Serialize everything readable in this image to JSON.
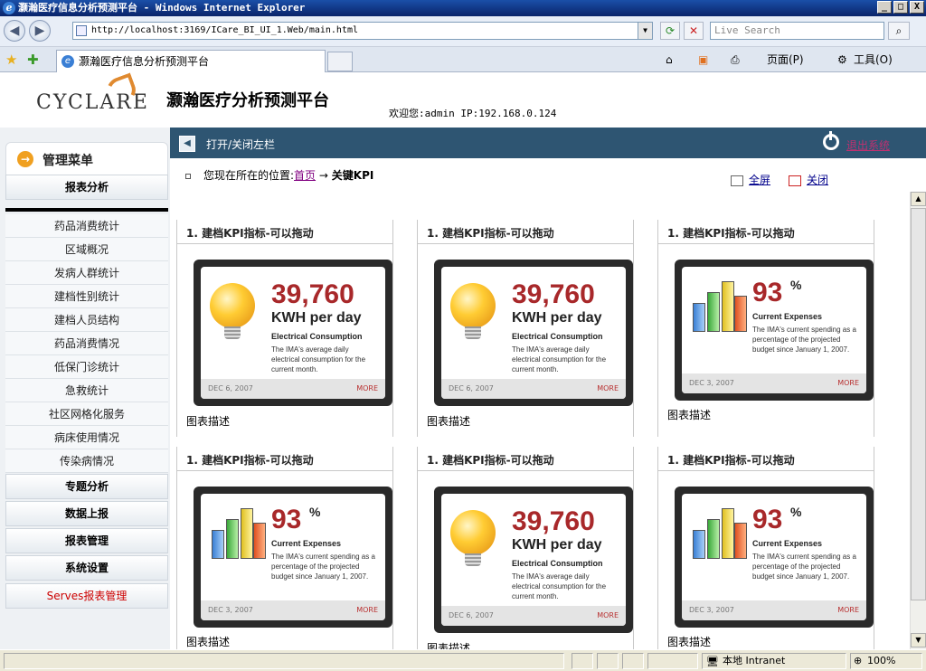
{
  "window": {
    "title": "灏瀚医疗信息分析预测平台 - Windows Internet Explorer",
    "buttons": [
      "_",
      "□",
      "X"
    ]
  },
  "browser": {
    "url": "http://localhost:3169/ICare_BI_UI_1.Web/main.html",
    "search_placeholder": "Live Search",
    "tab_label": "灏瀚医疗信息分析预测平台",
    "page_menu": "页面(P)",
    "tools_menu": "工具(O)"
  },
  "header": {
    "logo_text": "CYCLARE",
    "app_title": "灏瀚医疗分析预测平台",
    "welcome": "欢迎您:admin IP:192.168.0.124"
  },
  "topbar": {
    "toggle_label": "打开/关闭左栏",
    "logout_label": "退出系统"
  },
  "sidebar": {
    "menu_title": "管理菜单",
    "section_report": "报表分析",
    "items": [
      "药品消费统计",
      "区域概况",
      "发病人群统计",
      "建档性别统计",
      "建档人员结构",
      "药品消费情况",
      "低保门诊统计",
      "急救统计",
      "社区网格化服务",
      "病床使用情况",
      "传染病情况"
    ],
    "sections": [
      "专题分析",
      "数据上报",
      "报表管理",
      "系统设置"
    ],
    "serves_label": "Serves报表管理"
  },
  "breadcrumb": {
    "prefix": "您现在所在的位置:",
    "home": "首页",
    "arrow": "→",
    "current": "关键KPI"
  },
  "actions": {
    "fullscreen": "全屏",
    "close": "关闭"
  },
  "panels": [
    {
      "title": "1. 建档KPI指标-可以拖动",
      "desc": "图表描述",
      "kind": "energy"
    },
    {
      "title": "1. 建档KPI指标-可以拖动",
      "desc": "图表描述",
      "kind": "energy"
    },
    {
      "title": "1. 建档KPI指标-可以拖动",
      "desc": "图表描述",
      "kind": "expense"
    },
    {
      "title": "1. 建档KPI指标-可以拖动",
      "desc": "图表描述",
      "kind": "expense"
    },
    {
      "title": "1. 建档KPI指标-可以拖动",
      "desc": "图表描述",
      "kind": "energy"
    },
    {
      "title": "1. 建档KPI指标-可以拖动",
      "desc": "图表描述",
      "kind": "expense"
    }
  ],
  "energy_card": {
    "value": "39,760",
    "unit": "KWH per day",
    "subtitle": "Electrical Consumption",
    "text": "The IMA's average daily electrical consumption for the current month.",
    "date": "DEC 6, 2007",
    "more": "MORE"
  },
  "expense_card": {
    "value": "93",
    "percent": "%",
    "subtitle": "Current Expenses",
    "text": "The IMA's current spending as a percentage of the projected budget since January 1, 2007.",
    "date": "DEC 3, 2007",
    "more": "MORE"
  },
  "statusbar": {
    "zone": "本地 Intranet",
    "zoom": "100%"
  },
  "colors": {
    "bluebar": "#2e5572",
    "kpi_value": "#a8282a",
    "serves_label": "#cc0000"
  }
}
